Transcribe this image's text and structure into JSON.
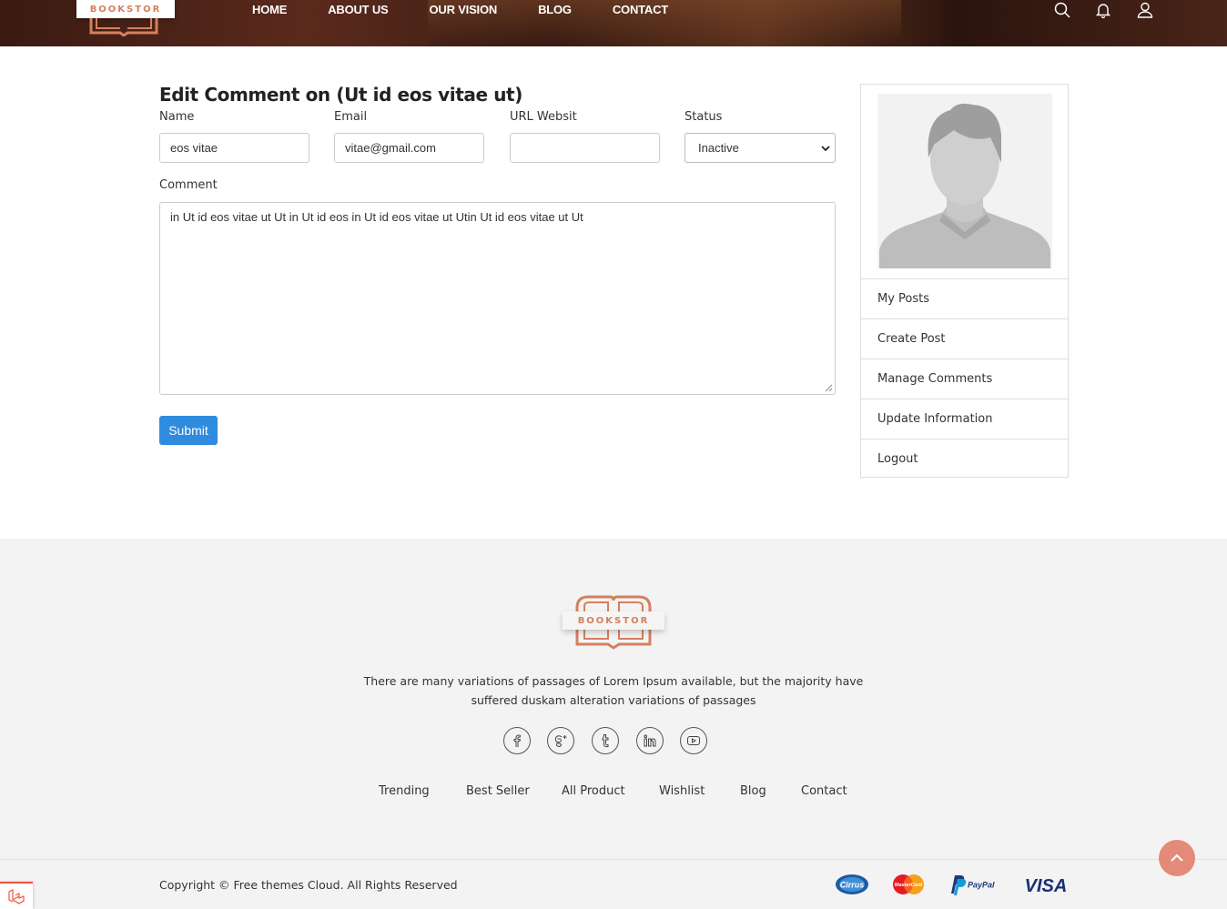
{
  "brand": {
    "name": "BOOKSTOR"
  },
  "nav": {
    "items": [
      "HOME",
      "ABOUT US",
      "OUR VISION",
      "BLOG",
      "CONTACT"
    ]
  },
  "header_icons": [
    "search-icon",
    "bell-icon",
    "user-icon"
  ],
  "form": {
    "title": "Edit Comment on (Ut id eos vitae ut)",
    "name_label": "Name",
    "name_value": "eos vitae",
    "email_label": "Email",
    "email_value": "vitae@gmail.com",
    "url_label": "URL Websit",
    "url_value": "",
    "status_label": "Status",
    "status_value": "Inactive",
    "comment_label": "Comment",
    "comment_value": "in Ut id eos vitae ut Ut in Ut id eos in Ut id eos vitae ut Utin Ut id eos vitae ut Ut",
    "submit_label": "Submit"
  },
  "sidebar": {
    "items": [
      {
        "label": "My Posts"
      },
      {
        "label": "Create Post"
      },
      {
        "label": "Manage Comments"
      },
      {
        "label": "Update Information"
      },
      {
        "label": "Logout"
      }
    ]
  },
  "footer": {
    "brand": "BOOKSTOR",
    "description": "There are many variations of passages of Lorem Ipsum available, but the majority have suffered duskam alteration variations of passages",
    "social": [
      "facebook-icon",
      "google-plus-icon",
      "tumblr-icon",
      "linkedin-icon",
      "youtube-icon"
    ],
    "links": [
      "Trending",
      "Best Seller",
      "All Product",
      "Wishlist",
      "Blog",
      "Contact"
    ],
    "copyright": "Copyright © Free themes Cloud. All Rights Reserved",
    "payments": {
      "cirrus": "Cirrus",
      "mastercard": "MasterCard",
      "paypal": "PayPal",
      "visa": "VISA"
    }
  },
  "colors": {
    "accent": "#d4805e",
    "submit": "#2e8bde",
    "scroll_top": "#e48a78",
    "footer_bg": "#f4f3f3"
  }
}
